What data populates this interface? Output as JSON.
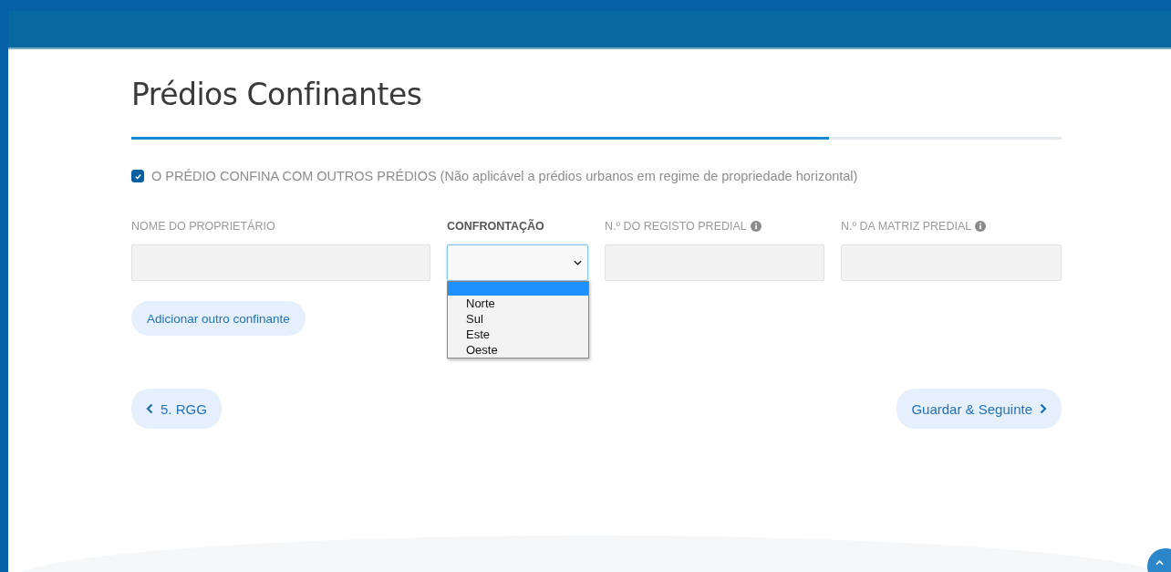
{
  "title": "Prédios Confinantes",
  "progress": {
    "level": 0.75
  },
  "confina": {
    "checked": true,
    "label": "O PRÉDIO CONFINA COM OUTROS PRÉDIOS",
    "note": "(Não aplicável a prédios urbanos em regime de propriedade horizontal)"
  },
  "fields": [
    {
      "label": "NOME DO PROPRIETÁRIO",
      "kind": "text",
      "info": false,
      "focused": false
    },
    {
      "label": "CONFRONTAÇÃO",
      "kind": "select",
      "info": false,
      "focused": true,
      "dropdown": {
        "blank_highlighted": true,
        "options": [
          "Norte",
          "Sul",
          "Este",
          "Oeste"
        ]
      }
    },
    {
      "label": "N.º DO REGISTO PREDIAL",
      "kind": "text",
      "info": true,
      "focused": false
    },
    {
      "label": "N.º DA MATRIZ PREDIAL",
      "kind": "text",
      "info": true,
      "focused": false
    }
  ],
  "add_button": "Adicionar outro confinante",
  "back_button": "5. RGG",
  "next_button": "Guardar & Seguinte"
}
